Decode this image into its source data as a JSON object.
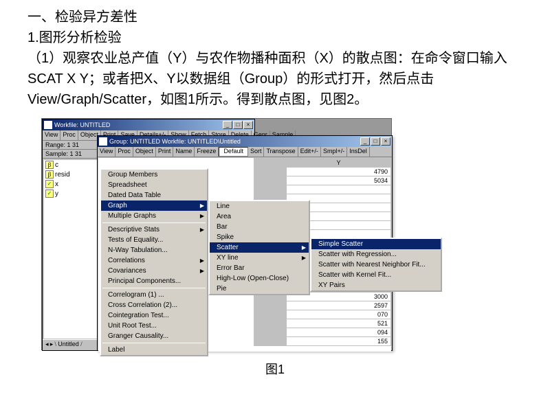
{
  "text": {
    "heading": "一、检验异方差性",
    "sub1": "1.图形分析检验",
    "para": "（1）观察农业总产值（Y）与农作物播种面积（X）的散点图：在命令窗口输入 SCAT X Y；或者把X、Y以数据组（Group）的形式打开，然后点击View/Graph/Scatter，如图1所示。得到散点图，见图2。",
    "caption": "图1"
  },
  "wf": {
    "title": "Workfile: UNTITLED",
    "toolbar": [
      "View",
      "Proc",
      "Object",
      "Print",
      "Save",
      "Details+/-",
      "Show",
      "Fetch",
      "Store",
      "Delete",
      "Genr",
      "Sample"
    ],
    "range": "Range: 1 31",
    "sample": "Sample: 1 31",
    "items": [
      {
        "icon": "β",
        "label": "c"
      },
      {
        "icon": "β",
        "label": "resid"
      },
      {
        "icon": "✓",
        "label": "x"
      },
      {
        "icon": "✓",
        "label": "y"
      }
    ],
    "status": "Untitled"
  },
  "grp": {
    "title": "Group: UNTITLED   Workfile: UNTITLED\\Untitled",
    "toolbar": [
      "View",
      "Proc",
      "Object",
      "Print",
      "Name",
      "Freeze",
      "Default",
      "Sort",
      "Transpose",
      "Edit+/-",
      "Smpl+/-",
      "InsDel"
    ],
    "col_header": "Y",
    "cells": [
      "4790",
      "5034",
      "",
      "",
      "",
      "",
      "",
      "",
      "",
      "",
      "",
      "",
      "",
      "",
      "3000",
      "2597",
      "070",
      "521",
      "094",
      "155"
    ]
  },
  "menu": {
    "main": [
      {
        "t": "Group Members"
      },
      {
        "t": "Spreadsheet"
      },
      {
        "t": "Dated Data Table"
      },
      {
        "t": "Graph",
        "sub": true,
        "hl": true
      },
      {
        "t": "Multiple Graphs",
        "sub": true
      },
      {
        "sep": true
      },
      {
        "t": "Descriptive Stats",
        "sub": true
      },
      {
        "t": "Tests of Equality..."
      },
      {
        "t": "N-Way Tabulation..."
      },
      {
        "t": "Correlations",
        "sub": true
      },
      {
        "t": "Covariances",
        "sub": true
      },
      {
        "t": "Principal Components..."
      },
      {
        "sep": true
      },
      {
        "t": "Correlogram (1) ..."
      },
      {
        "t": "Cross Correlation (2)..."
      },
      {
        "t": "Cointegration Test..."
      },
      {
        "t": "Unit Root Test..."
      },
      {
        "t": "Granger Causality..."
      },
      {
        "sep": true
      },
      {
        "t": "Label"
      }
    ],
    "graph": [
      {
        "t": "Line"
      },
      {
        "t": "Area"
      },
      {
        "t": "Bar"
      },
      {
        "t": "Spike"
      },
      {
        "t": "Scatter",
        "sub": true,
        "hl": true
      },
      {
        "t": "XY line",
        "sub": true
      },
      {
        "t": "Error Bar"
      },
      {
        "t": "High-Low (Open-Close)"
      },
      {
        "t": "Pie"
      }
    ],
    "scatter": [
      {
        "t": "Simple Scatter",
        "hl": true
      },
      {
        "t": "Scatter with Regression..."
      },
      {
        "t": "Scatter with Nearest Neighbor Fit..."
      },
      {
        "t": "Scatter with Kernel Fit..."
      },
      {
        "sep": true
      },
      {
        "t": "XY Pairs"
      }
    ]
  }
}
